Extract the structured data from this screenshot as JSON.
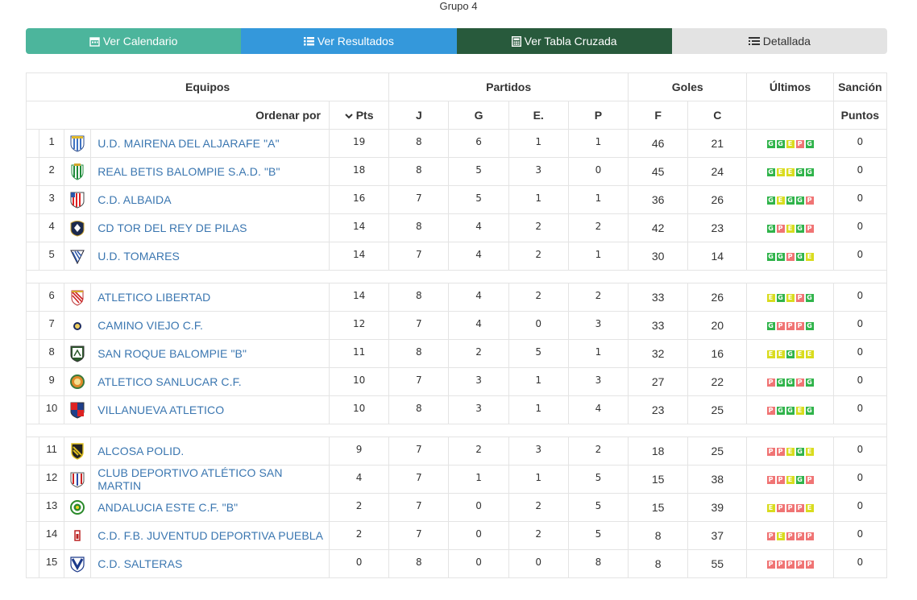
{
  "group_title": "Grupo 4",
  "tabs": [
    {
      "label": "Ver Calendario",
      "bg": "#4cb59c",
      "icon": "calendar-icon"
    },
    {
      "label": "Ver Resultados",
      "bg": "#3498db",
      "icon": "list-icon"
    },
    {
      "label": "Ver Tabla Cruzada",
      "bg": "#285a3c",
      "icon": "calculator-icon"
    },
    {
      "label": "Detallada",
      "bg": "#e3e3e3",
      "icon": "list-detail-icon"
    }
  ],
  "headers": {
    "equipos": "Equipos",
    "partidos": "Partidos",
    "goles": "Goles",
    "ultimos": "Últimos",
    "sancion": "Sanción",
    "ordenar_por": "Ordenar por",
    "pts": "Pts",
    "j": "J",
    "g": "G",
    "e": "E.",
    "p": "P",
    "f": "F",
    "c": "C",
    "puntos": "Puntos"
  },
  "colors": {
    "win": "#2fb34a",
    "draw": "#d9dc1f",
    "loss": "#f07474",
    "link": "#3a76b0"
  },
  "teams": [
    {
      "pos": "1",
      "name": "U.D. MAIRENA DEL ALJARAFE \"A\"",
      "pts": "19",
      "j": "8",
      "g": "6",
      "e": "1",
      "p": "1",
      "f": "46",
      "c": "21",
      "last": [
        "G",
        "G",
        "E",
        "P",
        "G"
      ],
      "sancion": "0",
      "crest": "stripes-blue"
    },
    {
      "pos": "2",
      "name": "REAL BETIS BALOMPIE S.A.D. \"B\"",
      "pts": "18",
      "j": "8",
      "g": "5",
      "e": "3",
      "p": "0",
      "f": "45",
      "c": "24",
      "last": [
        "G",
        "E",
        "E",
        "G",
        "G"
      ],
      "sancion": "0",
      "crest": "betis"
    },
    {
      "pos": "3",
      "name": "C.D. ALBAIDA",
      "pts": "16",
      "j": "7",
      "g": "5",
      "e": "1",
      "p": "1",
      "f": "36",
      "c": "26",
      "last": [
        "G",
        "E",
        "G",
        "G",
        "P"
      ],
      "sancion": "0",
      "crest": "redstripes"
    },
    {
      "pos": "4",
      "name": "CD TOR DEL REY DE PILAS",
      "pts": "14",
      "j": "8",
      "g": "4",
      "e": "2",
      "p": "2",
      "f": "42",
      "c": "23",
      "last": [
        "G",
        "P",
        "E",
        "G",
        "P"
      ],
      "sancion": "0",
      "crest": "navy"
    },
    {
      "pos": "5",
      "name": "U.D. TOMARES",
      "pts": "14",
      "j": "7",
      "g": "4",
      "e": "2",
      "p": "1",
      "f": "30",
      "c": "14",
      "last": [
        "G",
        "G",
        "P",
        "G",
        "E"
      ],
      "sancion": "0",
      "crest": "tomares"
    },
    {
      "pos": "6",
      "name": "ATLETICO LIBERTAD",
      "pts": "14",
      "j": "8",
      "g": "4",
      "e": "2",
      "p": "2",
      "f": "33",
      "c": "26",
      "last": [
        "E",
        "G",
        "E",
        "P",
        "G"
      ],
      "sancion": "0",
      "crest": "libertad"
    },
    {
      "pos": "7",
      "name": "CAMINO VIEJO C.F.",
      "pts": "12",
      "j": "7",
      "g": "4",
      "e": "0",
      "p": "3",
      "f": "33",
      "c": "20",
      "last": [
        "G",
        "P",
        "P",
        "P",
        "G"
      ],
      "sancion": "0",
      "crest": "camino"
    },
    {
      "pos": "8",
      "name": "SAN ROQUE BALOMPIE \"B\"",
      "pts": "11",
      "j": "8",
      "g": "2",
      "e": "5",
      "p": "1",
      "f": "32",
      "c": "16",
      "last": [
        "E",
        "E",
        "G",
        "E",
        "E"
      ],
      "sancion": "0",
      "crest": "sanroque"
    },
    {
      "pos": "9",
      "name": "ATLETICO SANLUCAR C.F.",
      "pts": "10",
      "j": "7",
      "g": "3",
      "e": "1",
      "p": "3",
      "f": "27",
      "c": "22",
      "last": [
        "P",
        "G",
        "G",
        "P",
        "G"
      ],
      "sancion": "0",
      "crest": "sanlucar"
    },
    {
      "pos": "10",
      "name": "VILLANUEVA ATLETICO",
      "pts": "10",
      "j": "8",
      "g": "3",
      "e": "1",
      "p": "4",
      "f": "23",
      "c": "25",
      "last": [
        "P",
        "G",
        "G",
        "E",
        "G"
      ],
      "sancion": "0",
      "crest": "villanueva"
    },
    {
      "pos": "11",
      "name": "ALCOSA POLID.",
      "pts": "9",
      "j": "7",
      "g": "2",
      "e": "3",
      "p": "2",
      "f": "18",
      "c": "25",
      "last": [
        "P",
        "P",
        "E",
        "G",
        "E"
      ],
      "sancion": "0",
      "crest": "alcosa"
    },
    {
      "pos": "12",
      "name": "CLUB DEPORTIVO ATLÉTICO SAN MARTIN",
      "pts": "4",
      "j": "7",
      "g": "1",
      "e": "1",
      "p": "5",
      "f": "15",
      "c": "38",
      "last": [
        "P",
        "P",
        "E",
        "G",
        "P"
      ],
      "sancion": "0",
      "crest": "sanmartin"
    },
    {
      "pos": "13",
      "name": "ANDALUCIA ESTE C.F. \"B\"",
      "pts": "2",
      "j": "7",
      "g": "0",
      "e": "2",
      "p": "5",
      "f": "15",
      "c": "39",
      "last": [
        "E",
        "P",
        "P",
        "P",
        "E"
      ],
      "sancion": "0",
      "crest": "andalucia"
    },
    {
      "pos": "14",
      "name": "C.D. F.B. JUVENTUD DEPORTIVA PUEBLA",
      "pts": "2",
      "j": "7",
      "g": "0",
      "e": "2",
      "p": "5",
      "f": "8",
      "c": "37",
      "last": [
        "P",
        "E",
        "P",
        "P",
        "P"
      ],
      "sancion": "0",
      "crest": "puebla"
    },
    {
      "pos": "15",
      "name": "C.D. SALTERAS",
      "pts": "0",
      "j": "8",
      "g": "0",
      "e": "0",
      "p": "8",
      "f": "8",
      "c": "55",
      "last": [
        "P",
        "P",
        "P",
        "P",
        "P"
      ],
      "sancion": "0",
      "crest": "salteras"
    }
  ],
  "spacers_after": [
    "5",
    "10"
  ]
}
